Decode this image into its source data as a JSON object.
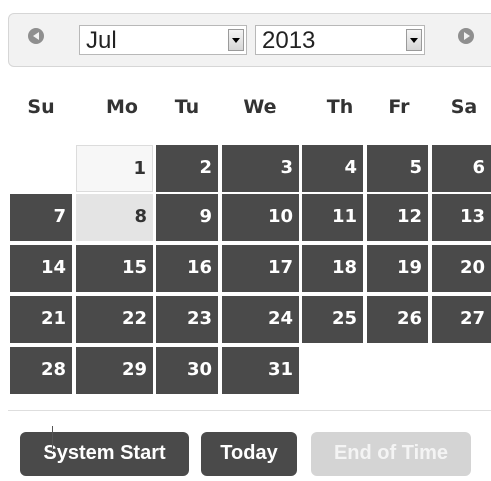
{
  "header": {
    "prev_icon": "circle-left-arrow",
    "next_icon": "circle-right-arrow",
    "month_value": "Jul",
    "year_value": "2013"
  },
  "weekdays": [
    "Su",
    "Mo",
    "Tu",
    "We",
    "Th",
    "Fr",
    "Sa"
  ],
  "days": [
    "1",
    "2",
    "3",
    "4",
    "5",
    "6",
    "7",
    "8",
    "9",
    "10",
    "11",
    "12",
    "13",
    "14",
    "15",
    "16",
    "17",
    "18",
    "19",
    "20",
    "21",
    "22",
    "23",
    "24",
    "25",
    "26",
    "27",
    "28",
    "29",
    "30",
    "31"
  ],
  "footer": {
    "system_start_label": "System Start",
    "today_label": "Today",
    "end_of_time_label": "End of Time"
  },
  "colors": {
    "day_bg": "#4a4a4a",
    "selected_bg": "#f7f7f7",
    "today_bg": "#e4e4e4",
    "disabled_btn": "#d4d4d4"
  }
}
